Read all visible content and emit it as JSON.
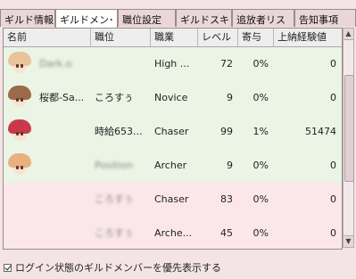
{
  "tabs": [
    {
      "label": "ギルド情報",
      "active": false
    },
    {
      "label": "ギルドメン･",
      "active": true
    },
    {
      "label": "職位設定",
      "active": false
    },
    {
      "label": "ギルドスキ",
      "active": false
    },
    {
      "label": "追放者リス",
      "active": false
    },
    {
      "label": "告知事項",
      "active": false
    }
  ],
  "columns": [
    "名前",
    "職位",
    "職業",
    "レベル",
    "寄与",
    "上納経験値"
  ],
  "rows": [
    {
      "name": "Dark.o",
      "position": "",
      "job": "High ...",
      "level": "72",
      "tax": "0%",
      "exp": "0",
      "online": true,
      "hair": "#e9c39a"
    },
    {
      "name": "桜都-Sa...",
      "position": "ころすぅ",
      "job": "Novice",
      "level": "9",
      "tax": "0%",
      "exp": "0",
      "online": true,
      "hair": "#9a6a4a"
    },
    {
      "name": "",
      "position": "時給653...",
      "job": "Chaser",
      "level": "99",
      "tax": "1%",
      "exp": "51474",
      "online": true,
      "hair": "#c83a4a"
    },
    {
      "name": "",
      "position": "Position",
      "job": "Archer",
      "level": "9",
      "tax": "0%",
      "exp": "0",
      "online": true,
      "hair": "#e9b080"
    },
    {
      "name": "",
      "position": "ころすぅ",
      "job": "Chaser",
      "level": "83",
      "tax": "0%",
      "exp": "0",
      "online": false,
      "hair": ""
    },
    {
      "name": "",
      "position": "ころすぅ",
      "job": "Arche...",
      "level": "45",
      "tax": "0%",
      "exp": "0",
      "online": false,
      "hair": ""
    }
  ],
  "footer": {
    "checkbox_label": "ログイン状態のギルドメンバーを優先表示する",
    "checked": true
  }
}
